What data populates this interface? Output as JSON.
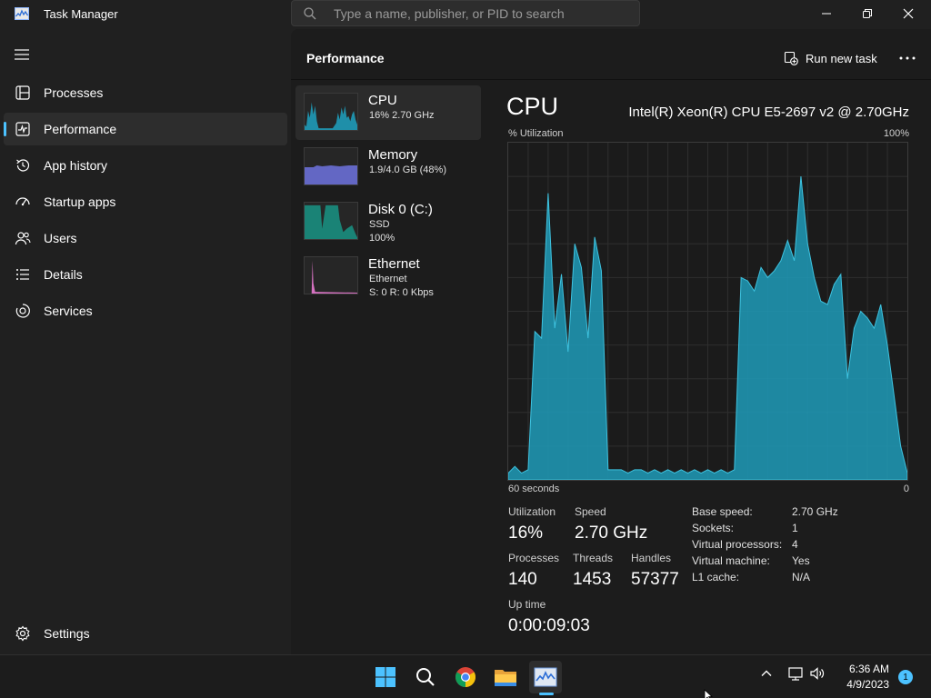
{
  "window": {
    "title": "Task Manager",
    "search_placeholder": "Type a name, publisher, or PID to search"
  },
  "sidebar": {
    "items": [
      {
        "label": "Processes",
        "icon": "processes-icon",
        "active": false
      },
      {
        "label": "Performance",
        "icon": "performance-icon",
        "active": true
      },
      {
        "label": "App history",
        "icon": "history-icon",
        "active": false
      },
      {
        "label": "Startup apps",
        "icon": "startup-icon",
        "active": false
      },
      {
        "label": "Users",
        "icon": "users-icon",
        "active": false
      },
      {
        "label": "Details",
        "icon": "details-icon",
        "active": false
      },
      {
        "label": "Services",
        "icon": "services-icon",
        "active": false
      }
    ],
    "settings_label": "Settings"
  },
  "header": {
    "title": "Performance",
    "run_new_task": "Run new task"
  },
  "devices": [
    {
      "name": "CPU",
      "sub1": "16%  2.70 GHz",
      "sub2": "",
      "active": true
    },
    {
      "name": "Memory",
      "sub1": "1.9/4.0 GB (48%)",
      "sub2": "",
      "active": false
    },
    {
      "name": "Disk 0 (C:)",
      "sub1": "SSD",
      "sub2": "100%",
      "active": false
    },
    {
      "name": "Ethernet",
      "sub1": "Ethernet",
      "sub2": "S: 0  R: 0 Kbps",
      "active": false
    }
  ],
  "detail": {
    "heading": "CPU",
    "model": "Intel(R) Xeon(R) CPU E5-2697 v2 @ 2.70GHz",
    "util_label": "% Utilization",
    "max_label": "100%",
    "time_label": "60 seconds",
    "time_zero": "0",
    "stats": {
      "utilization_label": "Utilization",
      "utilization": "16%",
      "speed_label": "Speed",
      "speed": "2.70 GHz",
      "processes_label": "Processes",
      "processes": "140",
      "threads_label": "Threads",
      "threads": "1453",
      "handles_label": "Handles",
      "handles": "57377",
      "uptime_label": "Up time",
      "uptime": "0:00:09:03"
    },
    "specs": [
      {
        "key": "Base speed:",
        "value": "2.70 GHz"
      },
      {
        "key": "Sockets:",
        "value": "1"
      },
      {
        "key": "Virtual processors:",
        "value": "4"
      },
      {
        "key": "Virtual machine:",
        "value": "Yes"
      },
      {
        "key": "L1 cache:",
        "value": "N/A"
      }
    ]
  },
  "chart_data": {
    "type": "area",
    "x": [
      0,
      1,
      2,
      3,
      4,
      5,
      6,
      7,
      8,
      9,
      10,
      11,
      12,
      13,
      14,
      15,
      16,
      17,
      18,
      19,
      20,
      21,
      22,
      23,
      24,
      25,
      26,
      27,
      28,
      29,
      30,
      31,
      32,
      33,
      34,
      35,
      36,
      37,
      38,
      39,
      40,
      41,
      42,
      43,
      44,
      45,
      46,
      47,
      48,
      49,
      50,
      51,
      52,
      53,
      54,
      55,
      56,
      57,
      58,
      59,
      60
    ],
    "values": [
      2,
      4,
      2,
      3,
      44,
      42,
      85,
      45,
      61,
      38,
      70,
      63,
      42,
      72,
      62,
      3,
      3,
      3,
      2,
      3,
      3,
      2,
      3,
      2,
      3,
      2,
      3,
      2,
      3,
      2,
      3,
      2,
      3,
      2,
      3,
      60,
      59,
      56,
      63,
      60,
      62,
      65,
      71,
      65,
      90,
      70,
      60,
      53,
      52,
      58,
      61,
      30,
      45,
      50,
      48,
      45,
      52,
      40,
      25,
      10,
      2
    ],
    "ylim": [
      0,
      100
    ],
    "xlim": [
      60,
      0
    ],
    "ylabel": "% Utilization",
    "xlabel": "60 seconds",
    "grid": true,
    "color": "#1f9bb8"
  },
  "taskbar": {
    "apps": [
      "start-icon",
      "search-icon",
      "chrome-icon",
      "file-explorer-icon",
      "task-manager-icon"
    ],
    "time": "6:36 AM",
    "date": "4/9/2023",
    "notification_count": "1"
  },
  "colors": {
    "accent": "#4cc2ff",
    "cpu": "#1f9bb8",
    "memory": "#6a6fd6",
    "ethernet": "#e87ad1"
  }
}
